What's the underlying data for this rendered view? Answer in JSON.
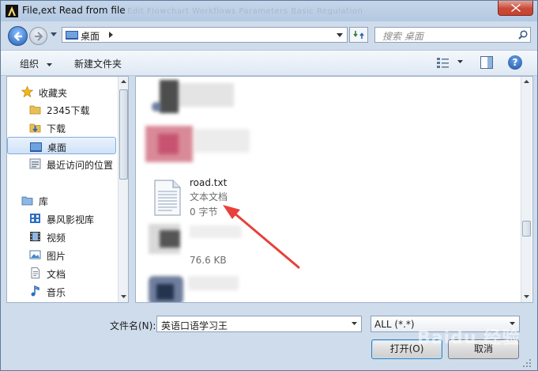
{
  "window": {
    "title": "File,ext Read from file",
    "ghost_menu": "Edit  Flowchart  Workflows  Parameters  Basic  Regulation"
  },
  "address": {
    "location": "桌面",
    "search_placeholder": "搜索 桌面"
  },
  "toolbar": {
    "organize": "组织",
    "new_folder": "新建文件夹",
    "help": "?"
  },
  "nav": {
    "favorites_label": "收藏夹",
    "favorites": [
      "2345下载",
      "下载",
      "桌面",
      "最近访问的位置"
    ],
    "library_label": "库",
    "libraries": [
      "暴风影视库",
      "视频",
      "图片",
      "文档",
      "音乐"
    ]
  },
  "files": {
    "highlighted_name": "road.txt",
    "highlighted_type": "文本文档",
    "highlighted_size": "0 字节",
    "other_size": "76.6 KB"
  },
  "bottom": {
    "filename_label": "文件名(N):",
    "filename_value": "英语口语学习王",
    "filter_value": "ALL (*.*)",
    "open_button": "打开(O)",
    "cancel_button": "取消"
  },
  "watermark": "Baidu 经验",
  "colors": {
    "arrow": "#e8403a",
    "close_button": "#c74a35"
  }
}
